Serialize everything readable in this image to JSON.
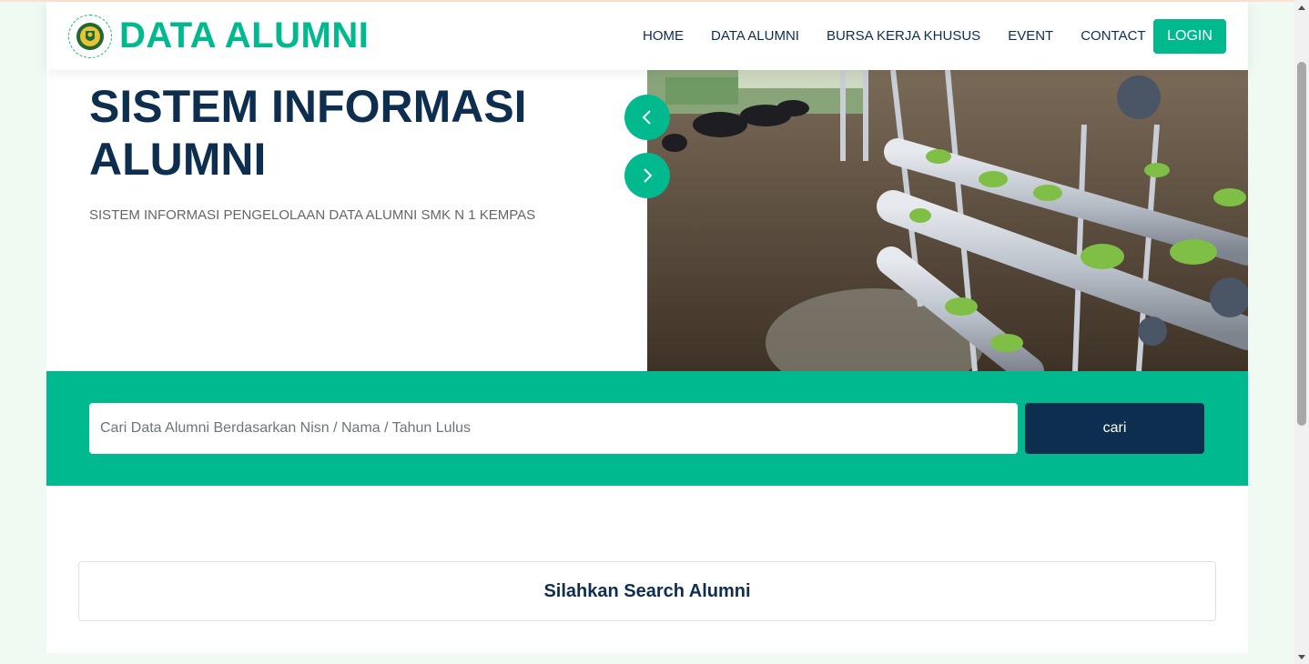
{
  "header": {
    "brand": "DATA ALUMNI",
    "nav": [
      "HOME",
      "DATA ALUMNI",
      "BURSA KERJA KHUSUS",
      "EVENT",
      "CONTACT"
    ],
    "login_label": "LOGIN"
  },
  "hero": {
    "title": "SISTEM INFORMASI ALUMNI",
    "subtitle": "SISTEM INFORMASI PENGELOLAAN DATA ALUMNI SMK N 1 KEMPAS",
    "prev_icon": "chevron-left-icon",
    "next_icon": "chevron-right-icon"
  },
  "search": {
    "placeholder": "Cari Data Alumni Berdasarkan Nisn / Nama / Tahun Lulus",
    "button_label": "cari"
  },
  "result": {
    "message": "Silahkan Search Alumni"
  },
  "colors": {
    "accent": "#00b98e",
    "dark": "#0e2e50",
    "background": "#effaf2"
  }
}
